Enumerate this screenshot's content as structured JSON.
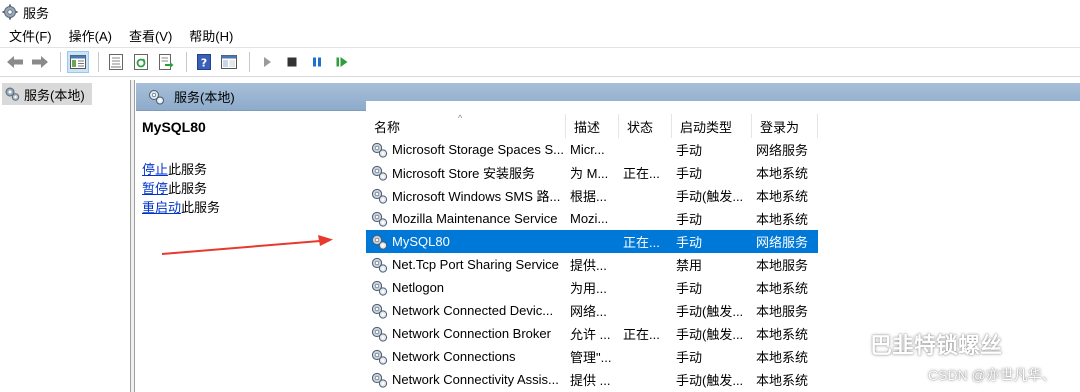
{
  "window": {
    "title": "服务",
    "icon": "gear-icon"
  },
  "menu": [
    "文件(F)",
    "操作(A)",
    "查看(V)",
    "帮助(H)"
  ],
  "toolbar": {
    "buttons": [
      "back-icon",
      "forward-icon",
      "show-hide-tree-icon",
      "properties-icon",
      "refresh-icon",
      "export-icon",
      "help-icon",
      "view-icon",
      "play-icon",
      "stop-icon",
      "pause-icon",
      "restart-icon"
    ]
  },
  "tree": {
    "item": "服务(本地)"
  },
  "pane": {
    "title": "服务(本地)"
  },
  "description": {
    "service_name": "MySQL80",
    "actions": [
      {
        "link": "停止",
        "rest": "此服务"
      },
      {
        "link": "暂停",
        "rest": "此服务"
      },
      {
        "link": "重启动",
        "rest": "此服务"
      }
    ]
  },
  "columns": [
    "名称",
    "描述",
    "状态",
    "启动类型",
    "登录为"
  ],
  "rows": [
    {
      "name": "Microsoft Storage Spaces S...",
      "desc": "Micr...",
      "status": "",
      "startup": "手动",
      "logon": "网络服务"
    },
    {
      "name": "Microsoft Store 安装服务",
      "desc": "为 M...",
      "status": "正在...",
      "startup": "手动",
      "logon": "本地系统"
    },
    {
      "name": "Microsoft Windows SMS 路...",
      "desc": "根据...",
      "status": "",
      "startup": "手动(触发...",
      "logon": "本地系统"
    },
    {
      "name": "Mozilla Maintenance Service",
      "desc": "Mozi...",
      "status": "",
      "startup": "手动",
      "logon": "本地系统"
    },
    {
      "name": "MySQL80",
      "desc": "",
      "status": "正在...",
      "startup": "手动",
      "logon": "网络服务",
      "selected": true
    },
    {
      "name": "Net.Tcp Port Sharing Service",
      "desc": "提供...",
      "status": "",
      "startup": "禁用",
      "logon": "本地服务"
    },
    {
      "name": "Netlogon",
      "desc": "为用...",
      "status": "",
      "startup": "手动",
      "logon": "本地系统"
    },
    {
      "name": "Network Connected Devic...",
      "desc": "网络...",
      "status": "",
      "startup": "手动(触发...",
      "logon": "本地服务"
    },
    {
      "name": "Network Connection Broker",
      "desc": "允许 ...",
      "status": "正在...",
      "startup": "手动(触发...",
      "logon": "本地系统"
    },
    {
      "name": "Network Connections",
      "desc": "管理\"...",
      "status": "",
      "startup": "手动",
      "logon": "本地系统"
    },
    {
      "name": "Network Connectivity Assis...",
      "desc": "提供 ...",
      "status": "",
      "startup": "手动(触发...",
      "logon": "本地系统"
    }
  ],
  "watermark": {
    "line1": "巴韭特锁螺丝",
    "line2": "CSDN @亦世凡华、"
  },
  "colors": {
    "selection": "#0078d7",
    "header_bar": "#9db6d3",
    "link": "#0033cc",
    "arrow": "#e8392f"
  }
}
